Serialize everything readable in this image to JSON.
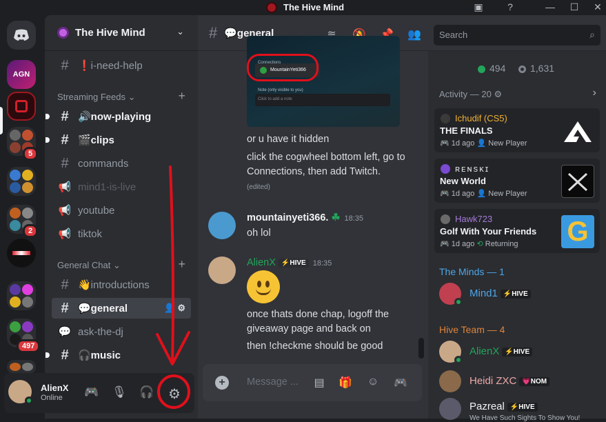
{
  "window": {
    "title": "The Hive Mind"
  },
  "guilds": {
    "agn_label": "AGN",
    "badges": [
      "5",
      "2",
      "497"
    ]
  },
  "server": {
    "name": "The Hive Mind"
  },
  "channels": {
    "top": [
      {
        "name": "❗i-need-help"
      }
    ],
    "streaming_category": "Streaming Feeds",
    "streaming": [
      {
        "name": "🔊now-playing"
      },
      {
        "name": "🎬clips"
      },
      {
        "name": "commands"
      },
      {
        "name": "mind1-is-live"
      },
      {
        "name": "youtube"
      },
      {
        "name": "tiktok"
      }
    ],
    "general_category": "General Chat",
    "general": [
      {
        "name": "👋introductions"
      },
      {
        "name": "💬general"
      },
      {
        "name": "ask-the-dj"
      },
      {
        "name": "🎧music"
      }
    ]
  },
  "user": {
    "name": "AlienX",
    "status": "Online"
  },
  "header": {
    "channel": "💬general",
    "search_placeholder": "Search"
  },
  "attachment": {
    "connections": "Connections",
    "account": "MountainYeti366",
    "note_label": "Note (only visible to you)",
    "note_placeholder": "Click to add a note"
  },
  "messages": [
    {
      "text": "or u have it hidden"
    },
    {
      "text": "click the cogwheel bottom left, go to Connections, then add Twitch.",
      "edited": "(edited)"
    },
    {
      "author": "mountainyeti366.",
      "time": "18:35",
      "text": "oh lol"
    },
    {
      "author": "AlienX",
      "tag": "⚡HIVE",
      "time": "18:35",
      "text1": "once thats done chap, logoff the giveaway page and back on",
      "text2": "then !checkme should be good"
    }
  ],
  "composer": {
    "placeholder": "Message ..."
  },
  "members": {
    "online": "494",
    "total": "1,631",
    "activity_header": "Activity — 20 ⚙",
    "activities": [
      {
        "user": "Ichudif (CS5)",
        "game": "THE FINALS",
        "meta": "1d ago",
        "tag": "New Player"
      },
      {
        "user": "ʀᴇɴsᴋɪ",
        "game": "New World",
        "meta": "1d ago",
        "tag": "New Player"
      },
      {
        "user": "Hawk723",
        "game": "Golf With Your Friends",
        "meta": "1d ago",
        "tag": "Returning"
      }
    ],
    "minds_header": "The Minds — 1",
    "minds": [
      {
        "name": "Mind1",
        "tag": "⚡HIVE"
      }
    ],
    "team_header": "Hive Team — 4",
    "team": [
      {
        "name": "AlienX",
        "tag": "⚡HIVE"
      },
      {
        "name": "Heidi ZXC",
        "tag": "💗NOM"
      },
      {
        "name": "Pazreal",
        "tag": "⚡HIVE",
        "sub": "We Have Such Sights To Show You!"
      }
    ]
  },
  "colors": {
    "accent": "#5865f2",
    "online": "#23a55a",
    "annotation": "#e0101b"
  }
}
